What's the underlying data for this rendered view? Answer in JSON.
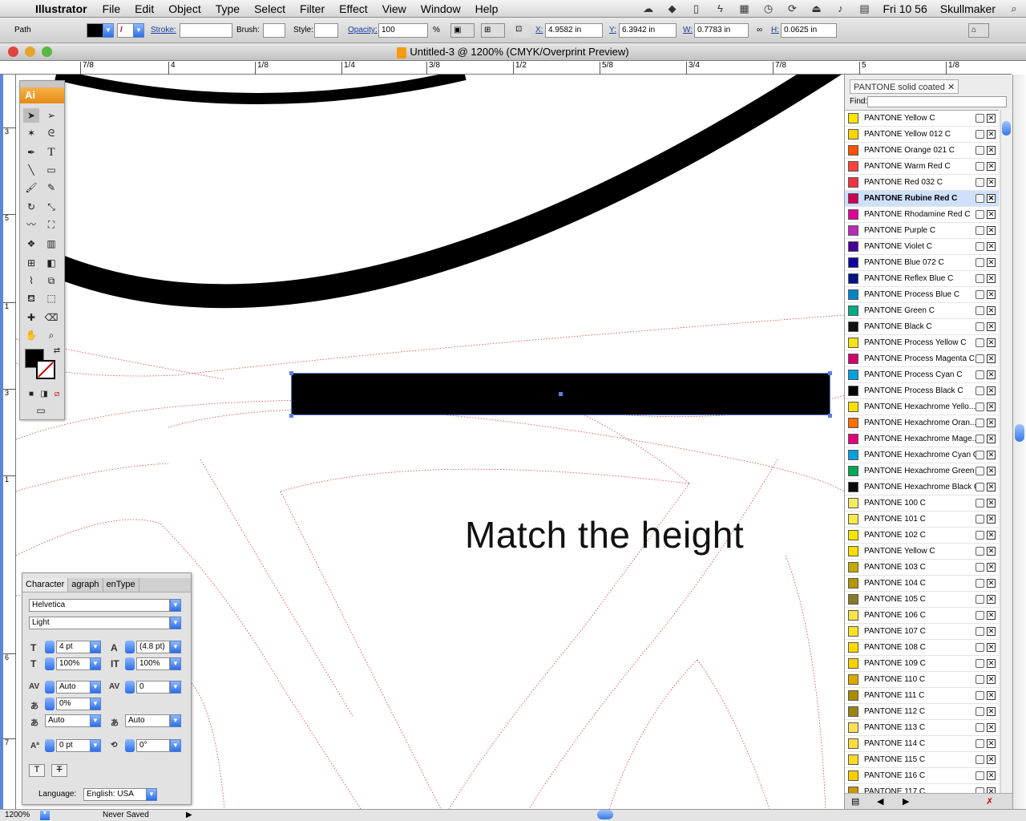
{
  "menubar": {
    "app": "Illustrator",
    "items": [
      "File",
      "Edit",
      "Object",
      "Type",
      "Select",
      "Filter",
      "Effect",
      "View",
      "Window",
      "Help"
    ],
    "clock": "Fri 10 56",
    "user": "Skullmaker"
  },
  "control": {
    "selection": "Path",
    "stroke_label": "Stroke:",
    "brush_label": "Brush:",
    "style_label": "Style:",
    "opacity_label": "Opacity:",
    "opacity_value": "100",
    "opacity_unit": "%",
    "x_label": "X:",
    "x_value": "4.9582 in",
    "y_label": "Y:",
    "y_value": "6.3942 in",
    "w_label": "W:",
    "w_value": "0.7783 in",
    "h_label": "H:",
    "h_value": "0.0625 in"
  },
  "window": {
    "title": "Untitled-3 @ 1200% (CMYK/Overprint Preview)"
  },
  "ruler_h": [
    "7/8",
    "4",
    "1/8",
    "1/4",
    "3/8",
    "1/2",
    "5/8",
    "3/4",
    "7/8",
    "5",
    "1/8"
  ],
  "ruler_v": [
    "3",
    "5",
    "1",
    "3",
    "1",
    "6",
    "7"
  ],
  "toolbox": {
    "logo": "Ai"
  },
  "canvas": {
    "text": "Match the height"
  },
  "character": {
    "tabs": [
      "Character",
      "agraph",
      "enType"
    ],
    "font_family": "Helvetica",
    "font_style": "Light",
    "size": "4 pt",
    "leading": "(4.8 pt)",
    "vscale": "100%",
    "hscale": "100%",
    "kerning": "Auto",
    "tracking": "0",
    "tsume": "0%",
    "aki_left": "Auto",
    "aki_right": "Auto",
    "baseline": "0 pt",
    "rotation": "0°",
    "language_label": "Language:",
    "language": "English: USA"
  },
  "swatches": {
    "tab": "PANTONE solid coated",
    "find_label": "Find:",
    "items": [
      {
        "name": "PANTONE Yellow C",
        "color": "#fde500"
      },
      {
        "name": "PANTONE Yellow 012 C",
        "color": "#ffd700"
      },
      {
        "name": "PANTONE Orange 021 C",
        "color": "#fe5000"
      },
      {
        "name": "PANTONE Warm Red C",
        "color": "#f9423a"
      },
      {
        "name": "PANTONE Red 032 C",
        "color": "#ef3340"
      },
      {
        "name": "PANTONE Rubine Red C",
        "color": "#ce0058",
        "selected": true
      },
      {
        "name": "PANTONE Rhodamine Red C",
        "color": "#e10098"
      },
      {
        "name": "PANTONE Purple C",
        "color": "#bb29bb"
      },
      {
        "name": "PANTONE Violet C",
        "color": "#440099"
      },
      {
        "name": "PANTONE Blue 072 C",
        "color": "#10069f"
      },
      {
        "name": "PANTONE Reflex Blue C",
        "color": "#001489"
      },
      {
        "name": "PANTONE Process Blue C",
        "color": "#0085ca"
      },
      {
        "name": "PANTONE Green C",
        "color": "#00ab84"
      },
      {
        "name": "PANTONE Black C",
        "color": "#111111"
      },
      {
        "name": "PANTONE Process Yellow C",
        "color": "#f7e214"
      },
      {
        "name": "PANTONE Process Magenta C",
        "color": "#d0006f"
      },
      {
        "name": "PANTONE Process Cyan C",
        "color": "#009fdf"
      },
      {
        "name": "PANTONE Process Black C",
        "color": "#000000"
      },
      {
        "name": "PANTONE Hexachrome Yello...",
        "color": "#ffe000"
      },
      {
        "name": "PANTONE Hexachrome Oran...",
        "color": "#ff6f00"
      },
      {
        "name": "PANTONE Hexachrome Mage...",
        "color": "#e0007a"
      },
      {
        "name": "PANTONE Hexachrome Cyan C",
        "color": "#00a0e0"
      },
      {
        "name": "PANTONE Hexachrome Green C",
        "color": "#00a650"
      },
      {
        "name": "PANTONE Hexachrome Black C",
        "color": "#0a0a0a"
      },
      {
        "name": "PANTONE 100 C",
        "color": "#f6eb61"
      },
      {
        "name": "PANTONE 101 C",
        "color": "#f7ea48"
      },
      {
        "name": "PANTONE 102 C",
        "color": "#fce300"
      },
      {
        "name": "PANTONE Yellow C",
        "color": "#fedd00"
      },
      {
        "name": "PANTONE 103 C",
        "color": "#c5a900"
      },
      {
        "name": "PANTONE 104 C",
        "color": "#af9800"
      },
      {
        "name": "PANTONE 105 C",
        "color": "#897a27"
      },
      {
        "name": "PANTONE 106 C",
        "color": "#f9e547"
      },
      {
        "name": "PANTONE 107 C",
        "color": "#fbe122"
      },
      {
        "name": "PANTONE 108 C",
        "color": "#fedb00"
      },
      {
        "name": "PANTONE 109 C",
        "color": "#ffd100"
      },
      {
        "name": "PANTONE 110 C",
        "color": "#daaa00"
      },
      {
        "name": "PANTONE 111 C",
        "color": "#aa8a00"
      },
      {
        "name": "PANTONE 112 C",
        "color": "#9c8412"
      },
      {
        "name": "PANTONE 113 C",
        "color": "#fae053"
      },
      {
        "name": "PANTONE 114 C",
        "color": "#fbdd40"
      },
      {
        "name": "PANTONE 115 C",
        "color": "#fdda24"
      },
      {
        "name": "PANTONE 116 C",
        "color": "#ffcd00"
      },
      {
        "name": "PANTONE 117 C",
        "color": "#c99700"
      }
    ]
  },
  "status": {
    "zoom": "1200%",
    "state": "Never Saved"
  }
}
